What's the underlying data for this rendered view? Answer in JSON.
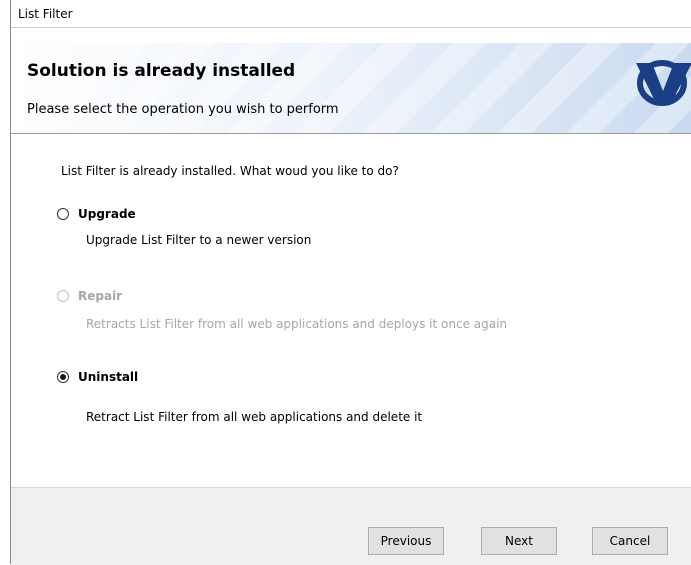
{
  "window": {
    "title": "List Filter"
  },
  "header": {
    "title": "Solution is already installed",
    "subtitle": "Please select the operation you wish to perform",
    "logo_icon": "brand-v-logo",
    "logo_color": "#1a3f86"
  },
  "content": {
    "question": "List Filter is already installed. What woud you like to do?",
    "options": [
      {
        "label": "Upgrade",
        "description": "Upgrade List Filter to a newer version",
        "selected": false,
        "enabled": true
      },
      {
        "label": "Repair",
        "description": "Retracts List Filter from all web applications and deploys it once again",
        "selected": false,
        "enabled": false
      },
      {
        "label": "Uninstall",
        "description": "Retract List Filter from all web applications and delete it",
        "selected": true,
        "enabled": true
      }
    ]
  },
  "footer": {
    "previous_label": "Previous",
    "next_label": "Next",
    "cancel_label": "Cancel"
  }
}
